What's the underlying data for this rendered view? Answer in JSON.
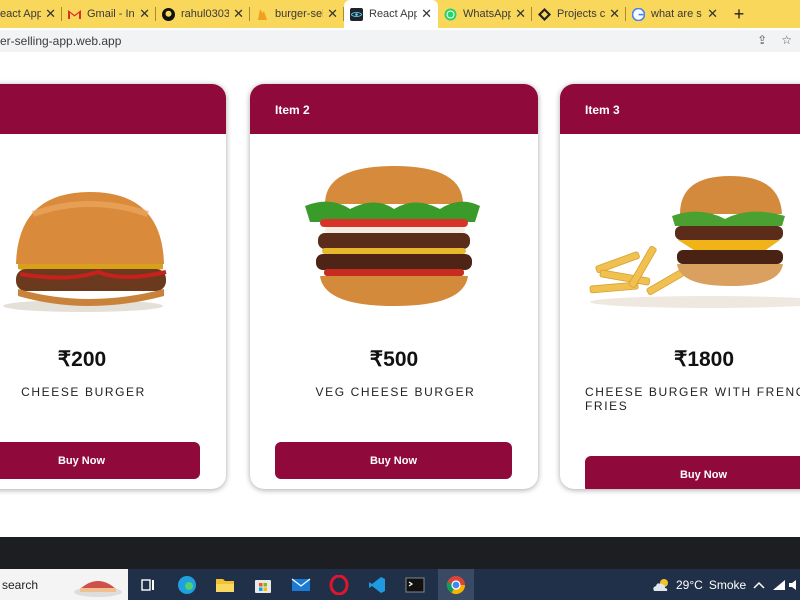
{
  "browser": {
    "tabs": [
      {
        "title": "eact App",
        "icon": "react-icon"
      },
      {
        "title": "Gmail - Inb",
        "icon": "gmail-icon"
      },
      {
        "title": "rahul0303",
        "icon": "github-icon"
      },
      {
        "title": "burger-sell",
        "icon": "firebase-icon"
      },
      {
        "title": "React App",
        "icon": "react-icon",
        "active": true
      },
      {
        "title": "WhatsApp",
        "icon": "whatsapp-icon"
      },
      {
        "title": "Projects cr",
        "icon": "project-icon"
      },
      {
        "title": "what are s",
        "icon": "google-icon"
      }
    ],
    "url": "er-selling-app.web.app"
  },
  "cards": [
    {
      "header": "",
      "price": "₹200",
      "name": "CHEESE BURGER",
      "button": "Buy Now"
    },
    {
      "header": "Item 2",
      "price": "₹500",
      "name": "VEG CHEESE BURGER",
      "button": "Buy Now"
    },
    {
      "header": "Item 3",
      "price": "₹1800",
      "name": "CHEESE BURGER WITH FRENCH FRIES",
      "button": "Buy Now"
    }
  ],
  "taskbar": {
    "search_label": "search",
    "weather_temp": "29°C",
    "weather_desc": "Smoke"
  },
  "colors": {
    "accent": "#8f0a3a",
    "tabstrip": "#f8d75a",
    "taskbar": "#203048"
  }
}
